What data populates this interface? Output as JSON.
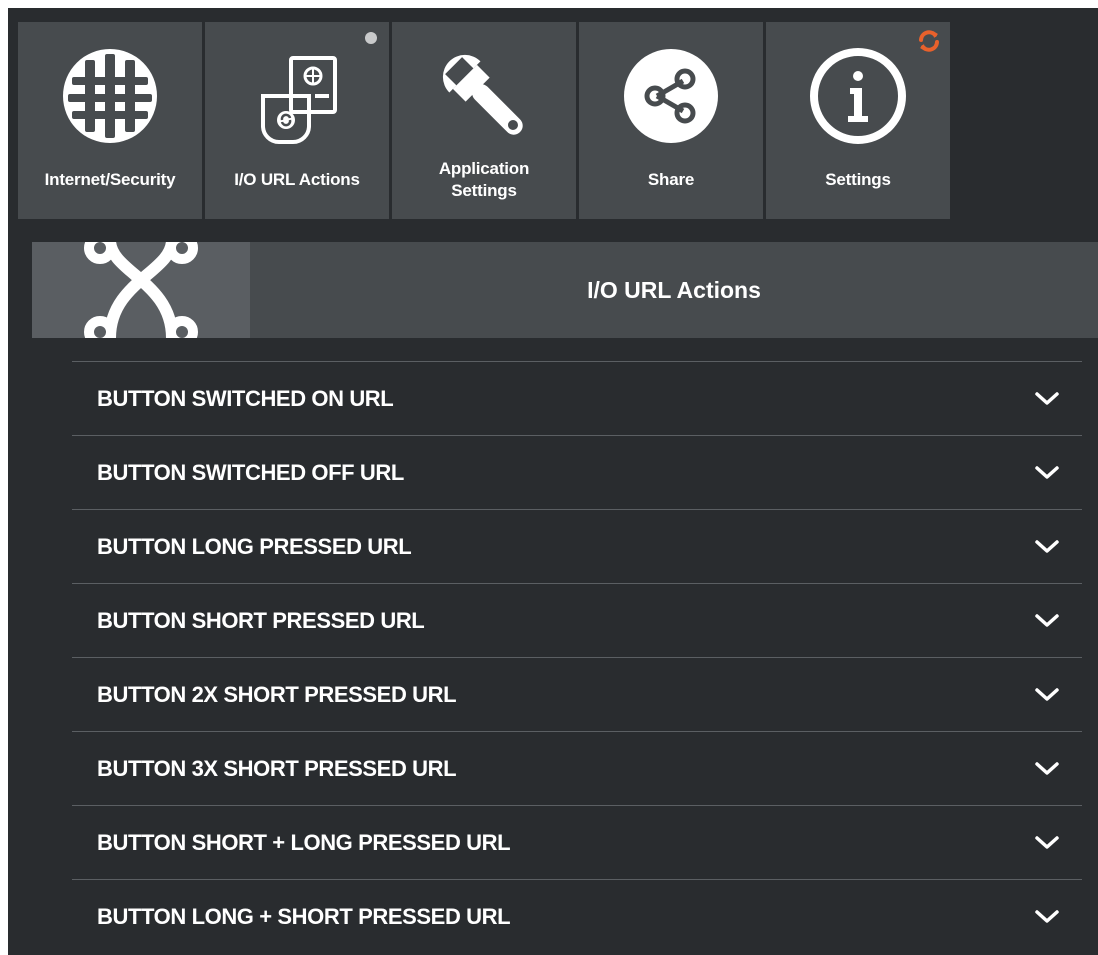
{
  "toolbar": {
    "tiles": [
      {
        "label": "Internet/Security",
        "icon": "globe-icon"
      },
      {
        "label": "I/O URL Actions",
        "icon": "io-url-actions-icon",
        "indicator": "status-dot"
      },
      {
        "label": "Application\nSettings",
        "icon": "wrench-icon"
      },
      {
        "label": "Share",
        "icon": "share-icon"
      },
      {
        "label": "Settings",
        "icon": "info-icon",
        "indicator": "sync-icon"
      }
    ]
  },
  "section": {
    "title": "I/O URL Actions",
    "icon": "connections-icon"
  },
  "url_actions": [
    {
      "label": "BUTTON SWITCHED ON URL",
      "icon": "chevron-down-icon"
    },
    {
      "label": "BUTTON SWITCHED OFF URL",
      "icon": "chevron-down-icon"
    },
    {
      "label": "BUTTON LONG PRESSED URL",
      "icon": "chevron-down-icon"
    },
    {
      "label": "BUTTON SHORT PRESSED URL",
      "icon": "chevron-down-icon"
    },
    {
      "label": "BUTTON 2X SHORT PRESSED URL",
      "icon": "chevron-down-icon"
    },
    {
      "label": "BUTTON 3X SHORT PRESSED URL",
      "icon": "chevron-down-icon"
    },
    {
      "label": "BUTTON SHORT + LONG PRESSED URL",
      "icon": "chevron-down-icon"
    },
    {
      "label": "BUTTON LONG + SHORT PRESSED URL",
      "icon": "chevron-down-icon"
    }
  ],
  "colors": {
    "background": "#292c2f",
    "tile": "#474b4e",
    "header_icon_box": "#5a5e62",
    "divider": "#5b5f63",
    "text": "#ffffff",
    "sync_accent": "#e8612c",
    "status_dot": "#c9cacb"
  }
}
